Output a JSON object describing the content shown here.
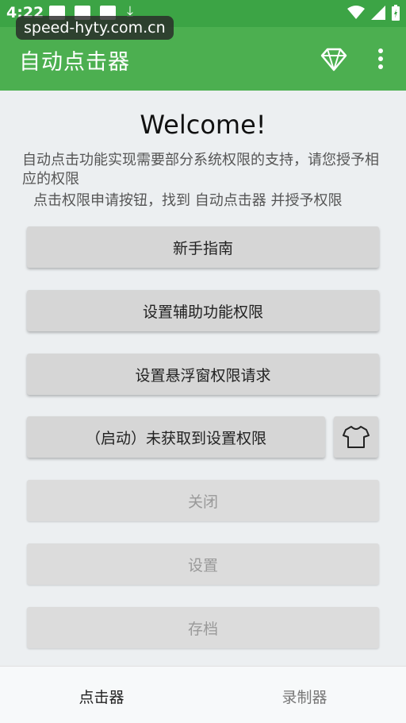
{
  "status_bar": {
    "time": "4:22"
  },
  "watermark": {
    "text": "speed-hyty.com.cn"
  },
  "app_bar": {
    "title": "自动点击器"
  },
  "welcome": "Welcome!",
  "description": "自动点击功能实现需要部分系统权限的支持，请您授予相应的权限",
  "hint": "点击权限申请按钮，找到 自动点击器 并授予权限",
  "buttons": {
    "guide": "新手指南",
    "accessibility": "设置辅助功能权限",
    "overlay": "设置悬浮窗权限请求",
    "start": "（启动）未获取到设置权限",
    "close": "关闭",
    "settings": "设置",
    "archive": "存档"
  },
  "bottom_nav": {
    "clicker": "点击器",
    "recorder": "录制器"
  },
  "colors": {
    "status_bar": "#3ca445",
    "app_bar": "#4caf50"
  }
}
